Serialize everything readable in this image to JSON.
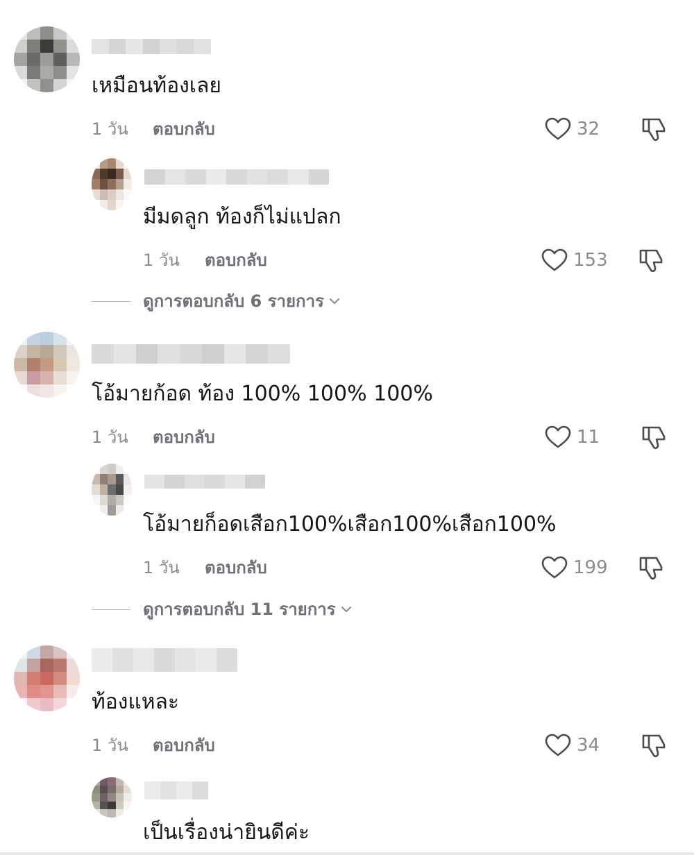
{
  "comments": [
    {
      "text": "เหมือนท้องเลย",
      "time": "1 วัน",
      "reply_label": "ตอบกลับ",
      "likes": "32",
      "replies": [
        {
          "text": "มีมดลูก ท้องก็ไม่แปลก",
          "time": "1 วัน",
          "reply_label": "ตอบกลับ",
          "likes": "153"
        }
      ],
      "view_replies_label": "ดูการตอบกลับ 6 รายการ"
    },
    {
      "text": "โอ้มายก้อด ท้อง 100% 100% 100%",
      "time": "1 วัน",
      "reply_label": "ตอบกลับ",
      "likes": "11",
      "replies": [
        {
          "text": "โอ้มายก็อดเสือก100%เสือก100%เสือก100%",
          "time": "1 วัน",
          "reply_label": "ตอบกลับ",
          "likes": "199"
        }
      ],
      "view_replies_label": "ดูการตอบกลับ 11 รายการ"
    },
    {
      "text": "ท้องแหละ",
      "time": "1 วัน",
      "reply_label": "ตอบกลับ",
      "likes": "34",
      "replies": [
        {
          "text": "เป็นเรื่องน่ายินดีค่ะ"
        }
      ]
    }
  ],
  "colors": {
    "text": "#161616",
    "muted": "#8a8b91",
    "action": "#6f7075",
    "icon": "#4a4b50",
    "divider": "#b9babe"
  },
  "icons": {
    "like": "heart-outline-icon",
    "dislike": "thumbs-down-icon",
    "expand": "chevron-down-icon"
  }
}
